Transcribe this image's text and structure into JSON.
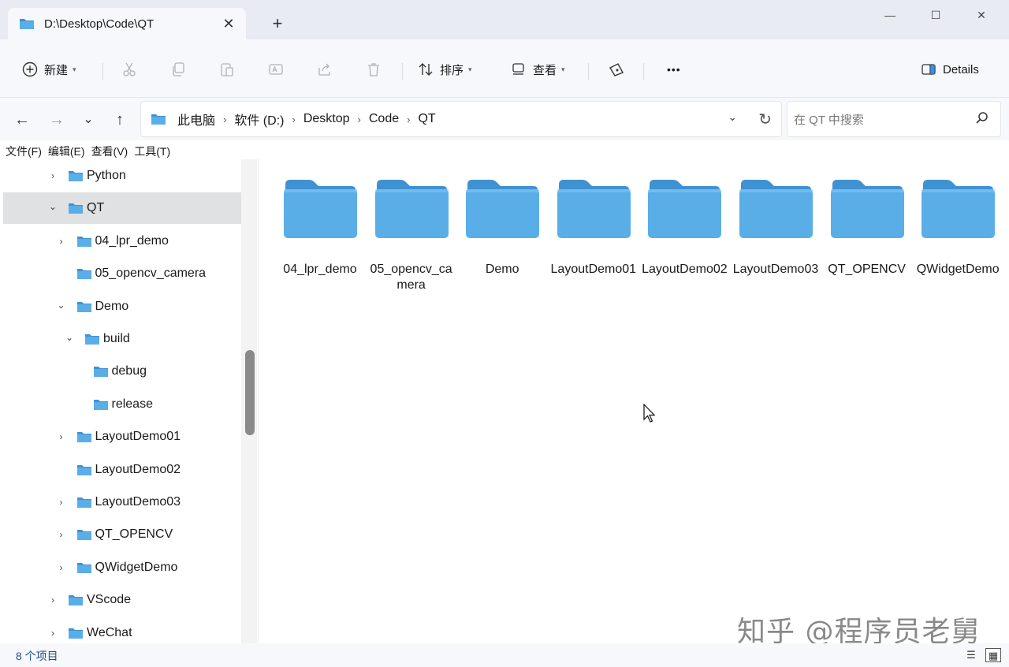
{
  "window": {
    "tab_title": "D:\\Desktop\\Code\\QT",
    "close_tab": "✕",
    "new_tab": "+",
    "minimize": "—",
    "maximize": "☐",
    "close": "✕"
  },
  "toolbar": {
    "new_label": "新建",
    "sort_label": "排序",
    "view_label": "查看",
    "more_label": "•••",
    "details_label": "Details",
    "icons": [
      "add-icon",
      "cut-icon",
      "copy-icon",
      "paste-icon",
      "rename-icon",
      "share-icon",
      "delete-icon",
      "sort-icon",
      "view-icon",
      "filter-icon",
      "more-icon",
      "details-pane-icon"
    ]
  },
  "nav": {
    "back": "←",
    "forward": "→",
    "recent": "⌄",
    "up": "↑",
    "breadcrumbs": [
      "此电脑",
      "软件 (D:)",
      "Desktop",
      "Code",
      "QT"
    ],
    "separator": "›",
    "dropdown": "⌄",
    "refresh": "↻",
    "search_placeholder": "在 QT 中搜索"
  },
  "menubar": [
    "文件(F)",
    "编辑(E)",
    "查看(V)",
    "工具(T)"
  ],
  "sidebar": {
    "items": [
      {
        "label": "Python",
        "expander": "›",
        "depth": 0,
        "selected": false
      },
      {
        "label": "QT",
        "expander": "⌄",
        "depth": 0,
        "selected": true
      },
      {
        "label": "04_lpr_demo",
        "expander": "›",
        "depth": 1,
        "selected": false
      },
      {
        "label": "05_opencv_camera",
        "expander": "",
        "depth": 1,
        "selected": false
      },
      {
        "label": "Demo",
        "expander": "⌄",
        "depth": 1,
        "selected": false
      },
      {
        "label": "build",
        "expander": "⌄",
        "depth": 2,
        "selected": false
      },
      {
        "label": "debug",
        "expander": "",
        "depth": 3,
        "selected": false
      },
      {
        "label": "release",
        "expander": "",
        "depth": 3,
        "selected": false
      },
      {
        "label": "LayoutDemo01",
        "expander": "›",
        "depth": 1,
        "selected": false
      },
      {
        "label": "LayoutDemo02",
        "expander": "",
        "depth": 1,
        "selected": false
      },
      {
        "label": "LayoutDemo03",
        "expander": "›",
        "depth": 1,
        "selected": false
      },
      {
        "label": "QT_OPENCV",
        "expander": "›",
        "depth": 1,
        "selected": false
      },
      {
        "label": "QWidgetDemo",
        "expander": "›",
        "depth": 1,
        "selected": false
      },
      {
        "label": "VScode",
        "expander": "›",
        "depth": 0,
        "selected": false
      },
      {
        "label": "WeChat",
        "expander": "›",
        "depth": 0,
        "selected": false
      }
    ]
  },
  "content": {
    "folders": [
      "04_lpr_demo",
      "05_opencv_camera",
      "Demo",
      "LayoutDemo01",
      "LayoutDemo02",
      "LayoutDemo03",
      "QT_OPENCV",
      "QWidgetDemo"
    ]
  },
  "status": {
    "item_count": "8 个项目",
    "details_view": "☰",
    "tiles_view": "▦"
  },
  "watermark": "知乎 @程序员老舅",
  "colors": {
    "folder_front": "#5aaee8",
    "folder_back": "#3f92d2",
    "selection": "#e0e1e3",
    "chrome": "#f7f8fb"
  }
}
